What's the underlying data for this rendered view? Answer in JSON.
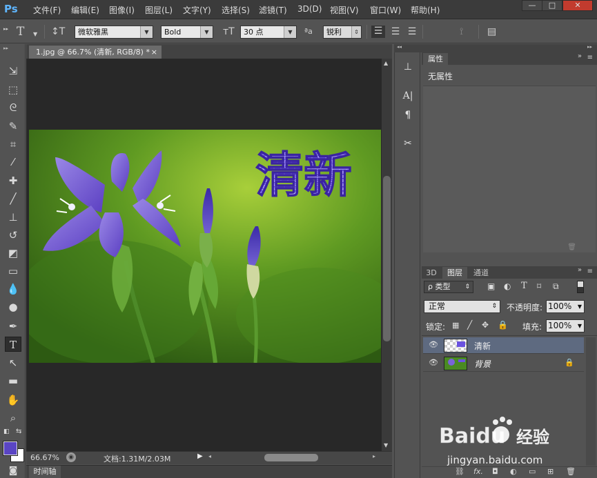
{
  "app": {
    "logo": "Ps"
  },
  "menu": [
    "文件(F)",
    "编辑(E)",
    "图像(I)",
    "图层(L)",
    "文字(Y)",
    "选择(S)",
    "滤镜(T)",
    "3D(D)",
    "视图(V)",
    "窗口(W)",
    "帮助(H)"
  ],
  "window_controls": {
    "minimize": "—",
    "restore": "□",
    "close": "✕"
  },
  "options": {
    "tool_glyph": "T",
    "font_family": "微软雅黑",
    "font_style": "Bold",
    "font_size": "30 点",
    "aa_label": "ªa",
    "antialias": "锐利",
    "text_color": "#5a45c4"
  },
  "document": {
    "tab_title": "1.jpg @ 66.7% (清新, RGB/8) *",
    "tab_close": "×",
    "image_text": "清新"
  },
  "status": {
    "zoom": "66.67%",
    "doc_info": "文档:1.31M/2.03M"
  },
  "timeline": {
    "label": "时间轴"
  },
  "colors": {
    "foreground": "#5a45c4",
    "background": "#ffffff"
  },
  "properties": {
    "tab": "属性",
    "message": "无属性"
  },
  "layers": {
    "tabs": [
      "3D",
      "图层",
      "通道"
    ],
    "filter_label": "ρ 类型",
    "blend_mode": "正常",
    "opacity_label": "不透明度:",
    "opacity": "100%",
    "lock_label": "锁定:",
    "fill_label": "填充:",
    "fill": "100%",
    "items": [
      {
        "name": "清新",
        "selected": true,
        "locked": false
      },
      {
        "name": "背景",
        "selected": false,
        "locked": true
      }
    ],
    "footer_fx": "fx."
  },
  "watermark": {
    "brand": "Baidu",
    "brand_cn": "经验",
    "url": "jingyan.baidu.com"
  }
}
